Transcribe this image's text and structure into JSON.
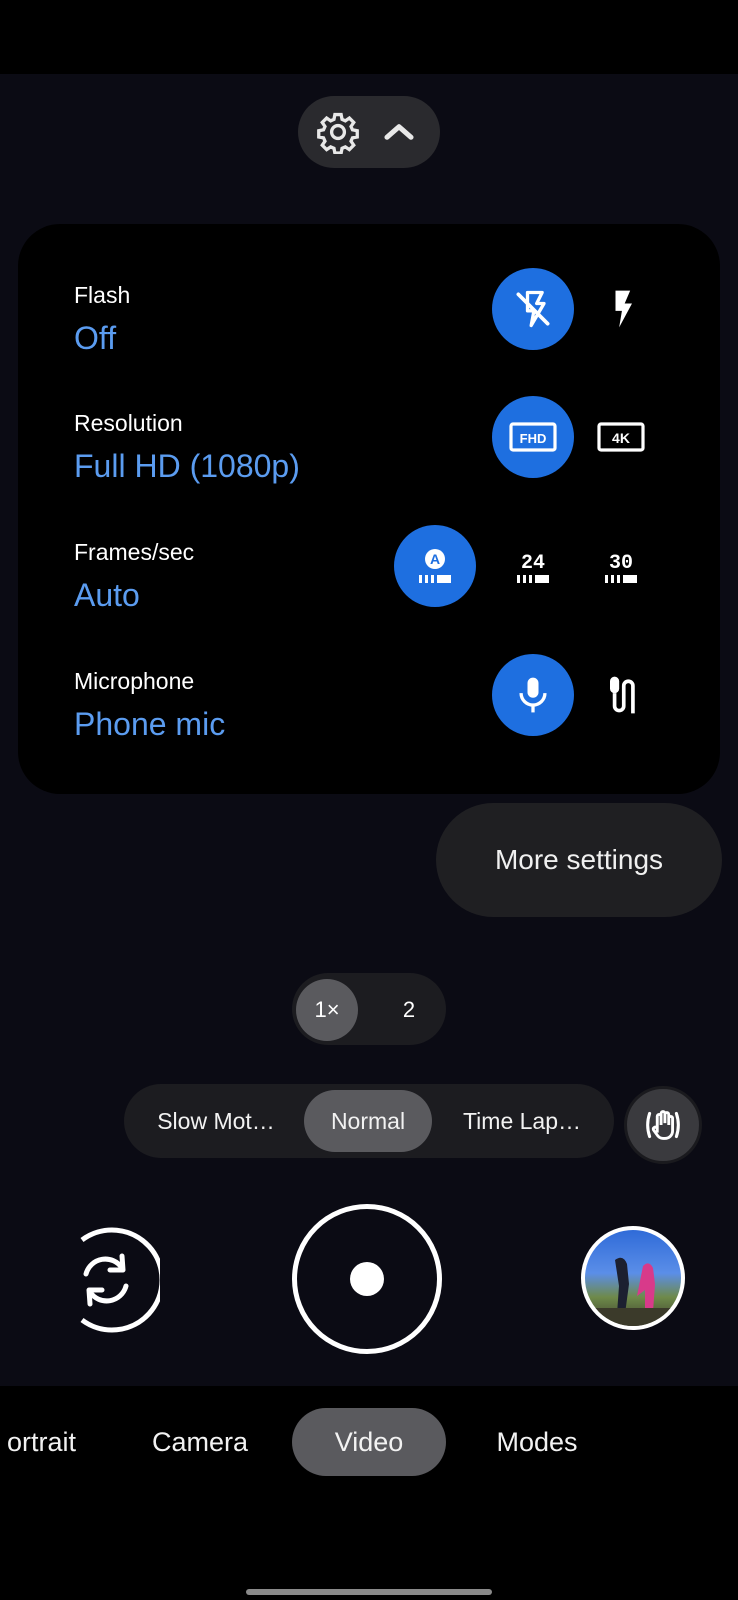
{
  "top_toolbar": {
    "settings_icon": "gear-icon",
    "collapse_icon": "chevron-up-icon"
  },
  "settings_panel": {
    "rows": [
      {
        "label": "Flash",
        "value": "Off",
        "options": [
          {
            "icon": "flash-off-icon",
            "selected": true
          },
          {
            "icon": "flash-on-icon",
            "selected": false
          }
        ]
      },
      {
        "label": "Resolution",
        "value": "Full HD (1080p)",
        "options": [
          {
            "icon": "fhd-icon",
            "text": "FHD",
            "selected": true
          },
          {
            "icon": "4k-icon",
            "text": "4K",
            "selected": false
          }
        ]
      },
      {
        "label": "Frames/sec",
        "value": "Auto",
        "options": [
          {
            "icon": "fps-auto-icon",
            "text": "A",
            "selected": true
          },
          {
            "icon": "fps-24-icon",
            "text": "24",
            "selected": false
          },
          {
            "icon": "fps-30-icon",
            "text": "30",
            "selected": false
          }
        ]
      },
      {
        "label": "Microphone",
        "value": "Phone mic",
        "options": [
          {
            "icon": "phone-mic-icon",
            "selected": true
          },
          {
            "icon": "external-mic-icon",
            "selected": false
          }
        ]
      }
    ],
    "more_settings": "More settings"
  },
  "zoom": {
    "options": [
      "1×",
      "2"
    ],
    "selected": "1×"
  },
  "speed_modes": {
    "options": [
      "Slow Mot…",
      "Normal",
      "Time Lap…"
    ],
    "selected": "Normal",
    "stabilization_icon": "stabilization-hand-icon"
  },
  "capture": {
    "switch_camera_icon": "switch-camera-icon",
    "record_icon": "record-icon",
    "gallery_icon": "gallery-thumbnail"
  },
  "camera_modes": {
    "options": [
      "ortrait",
      "Camera",
      "Video",
      "Modes"
    ],
    "selected": "Video"
  },
  "colors": {
    "accent": "#1e6fe0",
    "value_text": "#5b9cf0",
    "panel_bg": "#000000",
    "viewfinder_bg": "#0b0b14"
  }
}
